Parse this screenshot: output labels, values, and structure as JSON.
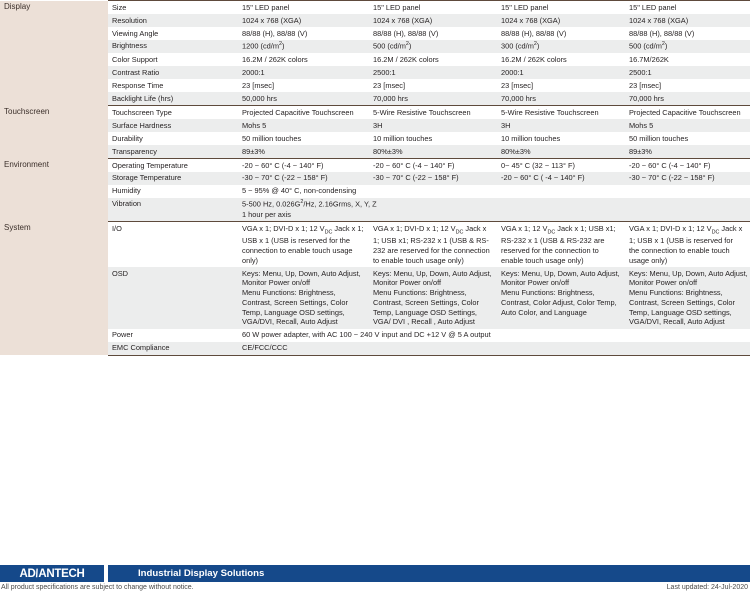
{
  "document": {
    "type": "product-specification-table",
    "columns": 4,
    "accent_blue": "#15498a",
    "group_bg": "#ece0d7",
    "stripe_bg": "#eceded"
  },
  "sections": [
    {
      "group": "Display",
      "rows": [
        {
          "param": "Size",
          "values": [
            "15\" LED panel",
            "15\" LED panel",
            "15\" LED panel",
            "15\" LED panel"
          ]
        },
        {
          "param": "Resolution",
          "values": [
            "1024 x 768 (XGA)",
            "1024 x 768 (XGA)",
            "1024 x 768 (XGA)",
            "1024 x 768 (XGA)"
          ]
        },
        {
          "param": "Viewing Angle",
          "values": [
            "88/88 (H), 88/88 (V)",
            "88/88 (H), 88/88 (V)",
            "88/88 (H), 88/88 (V)",
            "88/88 (H), 88/88 (V)"
          ]
        },
        {
          "param": "Brightness",
          "values": [
            "1200 (cd/m2)",
            "500 (cd/m2)",
            "300 (cd/m2)",
            "500 (cd/m2)"
          ]
        },
        {
          "param": "Color Support",
          "values": [
            "16.2M / 262K colors",
            "16.2M / 262K colors",
            "16.2M / 262K colors",
            "16.7M/262K"
          ]
        },
        {
          "param": "Contrast Ratio",
          "values": [
            "2000:1",
            "2500:1",
            "2000:1",
            "2500:1"
          ]
        },
        {
          "param": "Response Time",
          "values": [
            "23 [msec]",
            "23 [msec]",
            "23 [msec]",
            "23 [msec]"
          ]
        },
        {
          "param": "Backlight Life (hrs)",
          "values": [
            "50,000 hrs",
            "70,000 hrs",
            "70,000 hrs",
            "70,000 hrs"
          ]
        }
      ]
    },
    {
      "group": "Touchscreen",
      "rows": [
        {
          "param": "Touchscreen Type",
          "values": [
            "Projected Capacitive Touchscreen",
            "5-Wire Resistive Touchscreen",
            "5-Wire Resistive Touchscreen",
            "Projected Capacitive Touchscreen"
          ]
        },
        {
          "param": "Surface Hardness",
          "values": [
            "Mohs 5",
            "3H",
            "3H",
            "Mohs 5"
          ]
        },
        {
          "param": "Durability",
          "values": [
            "50 million touches",
            "10 million  touches",
            "10 million touches",
            "50 million touches"
          ]
        },
        {
          "param": "Transparency",
          "values": [
            "89±3%",
            "80%±3%",
            "80%±3%",
            "89±3%"
          ]
        }
      ]
    },
    {
      "group": "Environment",
      "rows": [
        {
          "param": "Operating Temperature",
          "values": [
            "-20 ~ 60° C (-4 ~ 140° F)",
            "-20 ~ 60° C (-4 ~ 140° F)",
            "0~ 45° C (32 ~ 113° F)",
            "-20 ~ 60° C (-4 ~ 140° F)"
          ]
        },
        {
          "param": "Storage Temperature",
          "values": [
            "-30 ~ 70° C (-22 ~ 158° F)",
            "-30 ~ 70° C (-22 ~ 158° F)",
            "-20 ~ 60° C ( -4 ~ 140° F)",
            "-30 ~ 70° C (-22 ~ 158° F)"
          ]
        },
        {
          "param": "Humidity",
          "span": true,
          "values": [
            "5 ~ 95% @ 40° C, non-condensing"
          ]
        },
        {
          "param": "Vibration",
          "span": true,
          "values": [
            "5-500 Hz, 0.026G2/Hz, 2.16Grms, X, Y, Z\n1 hour per axis"
          ]
        }
      ]
    },
    {
      "group": "System",
      "rows": [
        {
          "param": "I/O",
          "values": [
            "VGA x 1; DVI-D x 1; 12 VDC Jack x 1; USB x 1 (USB is reserved for the connection to enable touch usage only)",
            "VGA x 1; DVI-D x 1; 12 VDC Jack x 1; USB x1; RS-232 x 1 (USB & RS-232 are reserved for the connection to enable touch usage only)",
            "VGA x 1; 12 VDC  Jack x 1; USB x1; RS-232 x 1 (USB & RS-232 are reserved for the connection to enable touch usage only)",
            "VGA x 1; DVI-D x 1; 12 VDC Jack x 1; USB x 1 (USB is reserved for\nthe connection to enable touch usage only)"
          ]
        },
        {
          "param": "OSD",
          "values": [
            "Keys: Menu, Up, Down, Auto Adjust, Monitor Power on/off\nMenu Functions: Brightness, Contrast, Screen Settings, Color Temp, Language OSD settings, VGA/DVI, Recall, Auto Adjust",
            "Keys: Menu, Up, Down, Auto Adjust, Monitor Power on/off\nMenu Functions: Brightness, Contrast, Screen Settings, Color Temp, Language  OSD Settings,\nVGA/ DVI , Recall , Auto Adjust",
            "Keys: Menu, Up, Down, Auto Adjust, Monitor Power on/off\nMenu Functions: Brightness, Contrast, Color Adjust, Color Temp, Auto Color, and Language",
            "Keys: Menu, Up, Down, Auto Adjust, Monitor Power on/off\nMenu Functions: Brightness, Contrast, Screen Settings, Color Temp, Language OSD settings, VGA/DVI, Recall, Auto Adjust"
          ]
        },
        {
          "param": "Power",
          "span": true,
          "values": [
            "60 W power adapter, with AC 100 ~ 240 V input and DC +12 V @ 5 A output"
          ]
        },
        {
          "param": "EMC Compliance",
          "span": true,
          "values": [
            "CE/FCC/CCC"
          ]
        }
      ]
    }
  ],
  "footer": {
    "brand_part1": "AD",
    "brand_slash": "\\",
    "brand_part2": "ANTECH",
    "brand_full": "ADVANTECH",
    "tagline": "Industrial Display Solutions",
    "disclaimer": "All product specifications are subject to change without notice.",
    "last_updated": "Last updated: 24-Jul-2020"
  }
}
